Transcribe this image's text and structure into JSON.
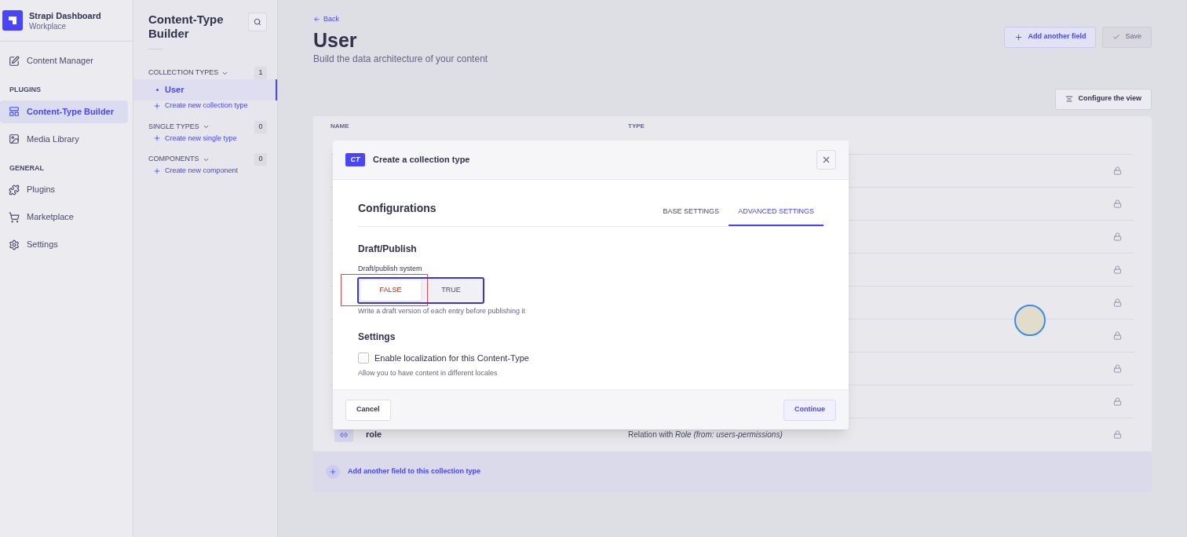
{
  "nav": {
    "brand": "Strapi Dashboard",
    "workspace": "Workplace",
    "sections": [
      {
        "items": [
          {
            "label": "Content Manager",
            "selected": false
          }
        ]
      },
      {
        "title": "PLUGINS",
        "items": [
          {
            "label": "Content-Type Builder",
            "selected": true
          },
          {
            "label": "Media Library",
            "selected": false
          }
        ]
      },
      {
        "title": "GENERAL",
        "items": [
          {
            "label": "Plugins",
            "selected": false
          },
          {
            "label": "Marketplace",
            "selected": false
          },
          {
            "label": "Settings",
            "selected": false
          }
        ]
      }
    ]
  },
  "builder": {
    "title": "Content-Type Builder",
    "groups": [
      {
        "title": "COLLECTION TYPES",
        "count": "1",
        "items": [
          {
            "label": "User",
            "selected": true
          }
        ],
        "create": "Create new collection type"
      },
      {
        "title": "SINGLE TYPES",
        "count": "0",
        "create": "Create new single type"
      },
      {
        "title": "COMPONENTS",
        "count": "0",
        "create": "Create new component"
      }
    ]
  },
  "header": {
    "back": "Back",
    "title": "User",
    "subtitle": "Build the data architecture of your content",
    "buttons": [
      {
        "label": "Add another field",
        "kind": "primary"
      },
      {
        "label": "Save",
        "kind": "disabled"
      }
    ],
    "configure": "Configure the view"
  },
  "table": {
    "columns": [
      "NAME",
      "TYPE"
    ],
    "rows": [
      {
        "locked": true
      },
      {
        "locked": true
      },
      {
        "locked": true
      },
      {
        "locked": true
      },
      {
        "locked": true
      },
      {
        "locked": true
      },
      {
        "locked": true
      },
      {
        "locked": true
      },
      {
        "name": "role",
        "type": "Relation with *Role (from: users-permissions)*",
        "locked": true
      }
    ],
    "add": "Add another field to this collection type"
  },
  "modal": {
    "badge": "CT",
    "title": "Create a collection type",
    "heading": "Configurations",
    "tabs": [
      {
        "label": "BASE SETTINGS",
        "selected": false
      },
      {
        "label": "ADVANCED SETTINGS",
        "selected": true
      }
    ],
    "draft": {
      "heading": "Draft/Publish",
      "label": "Draft/publish system",
      "options": [
        {
          "label": "FALSE",
          "selected": true
        },
        {
          "label": "TRUE",
          "selected": false
        }
      ],
      "hint": "Write a draft version of each entry before publishing it"
    },
    "settings": {
      "heading": "Settings",
      "label": "Enable localization for this Content-Type",
      "checked": false,
      "hint": "Allow you to have content in different locales"
    },
    "footer": {
      "cancel": "Cancel",
      "continue": "Continue"
    }
  },
  "annotations": [
    {
      "color": "#e0474c"
    },
    {
      "color": "#3a33e6"
    }
  ]
}
